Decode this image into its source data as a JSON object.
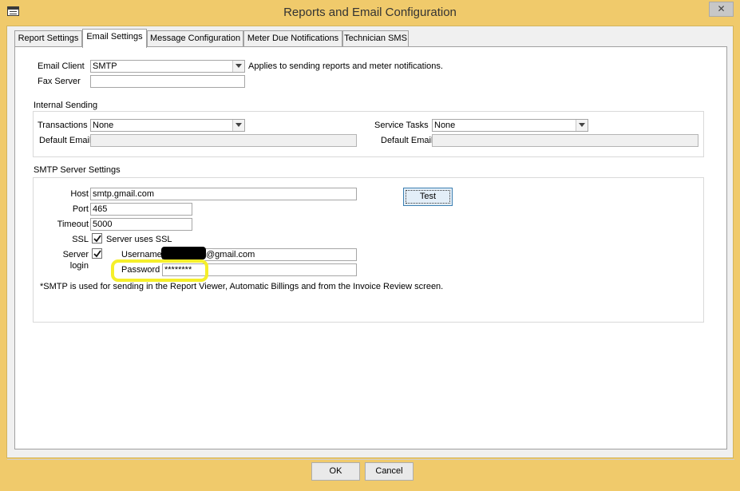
{
  "window": {
    "title": "Reports and Email Configuration",
    "close_glyph": "✕"
  },
  "tabs": [
    {
      "label": "Report Settings"
    },
    {
      "label": "Email Settings",
      "active": true
    },
    {
      "label": "Message Configuration"
    },
    {
      "label": "Meter Due Notifications"
    },
    {
      "label": "Technician SMS"
    }
  ],
  "general": {
    "email_client_label": "Email Client",
    "email_client_value": "SMTP",
    "email_client_note": "Applies to sending reports and meter notifications.",
    "fax_server_label": "Fax Server",
    "fax_server_value": ""
  },
  "internal_sending": {
    "heading": "Internal Sending",
    "transactions_label": "Transactions",
    "transactions_value": "None",
    "default_email_label": "Default Email",
    "default_email_value": "",
    "service_tasks_label": "Service Tasks",
    "service_tasks_value": "None",
    "service_default_email_label": "Default Email",
    "service_default_email_value": ""
  },
  "smtp": {
    "heading": "SMTP Server Settings",
    "host_label": "Host",
    "host_value": "smtp.gmail.com",
    "port_label": "Port",
    "port_value": "465",
    "timeout_label": "Timeout",
    "timeout_value": "5000",
    "ssl_label": "SSL",
    "ssl_checked": true,
    "ssl_text": "Server uses SSL",
    "server_label": "Server",
    "login_label": "login",
    "server_login_checked": true,
    "username_label": "Username",
    "username_value": "@gmail.com",
    "password_label": "Password",
    "password_value": "********",
    "test_button": "Test",
    "note": "*SMTP is used for sending in the Report Viewer, Automatic Billings and from the Invoice Review screen."
  },
  "footer": {
    "ok_label": "OK",
    "cancel_label": "Cancel"
  },
  "colors": {
    "window_frame": "#f0ca6b",
    "highlight": "#f5ef2a",
    "focus_border": "#3c7fb1"
  }
}
